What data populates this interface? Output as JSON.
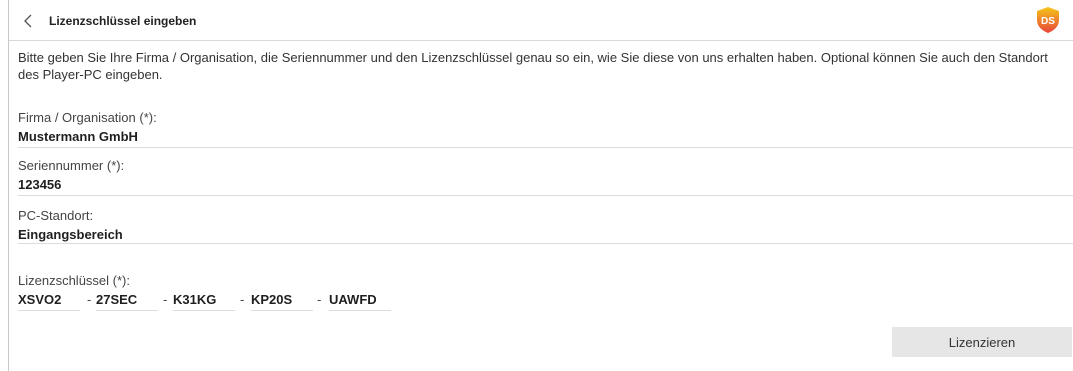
{
  "header": {
    "title": "Lizenzschlüssel eingeben",
    "logo_text": "DS",
    "colors": {
      "logo_top": "#f5c518",
      "logo_bottom": "#e8453c"
    }
  },
  "intro_text": "Bitte geben Sie Ihre Firma / Organisation, die Seriennummer und den Lizenzschlüssel genau so ein, wie Sie diese von uns erhalten haben. Optional können Sie auch den Standort des Player-PC eingeben.",
  "fields": {
    "company": {
      "label": "Firma / Organisation (*):",
      "value": "Mustermann GmbH"
    },
    "serial": {
      "label": "Seriennummer (*):",
      "value": "123456"
    },
    "location": {
      "label": "PC-Standort:",
      "value": "Eingangsbereich"
    }
  },
  "license": {
    "label": "Lizenzschlüssel (*):",
    "separator": "-",
    "segments": [
      "XSVO2",
      "27SEC",
      "K31KG",
      "KP20S",
      "UAWFD"
    ]
  },
  "submit_label": "Lizenzieren"
}
